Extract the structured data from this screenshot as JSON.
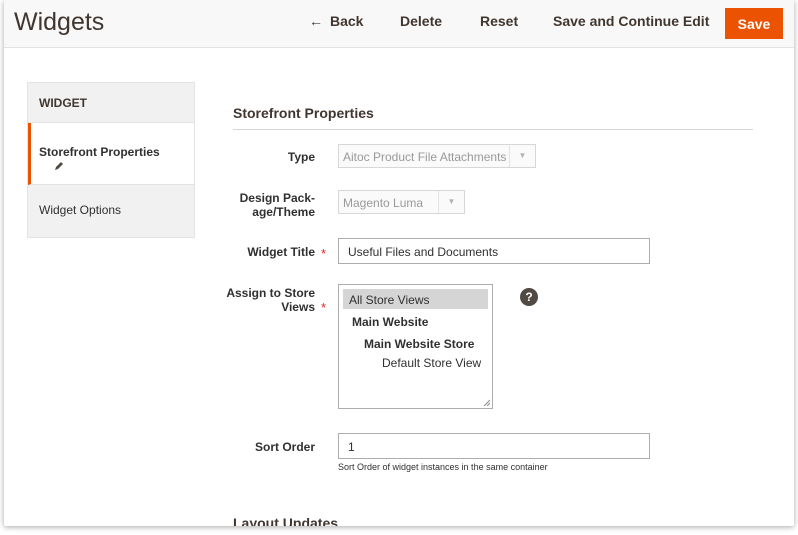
{
  "header": {
    "title": "Widgets",
    "back_label": "Back",
    "back_arrow": "←",
    "delete_label": "Delete",
    "reset_label": "Reset",
    "save_continue_label": "Save and Continue Edit",
    "save_label": "Save",
    "accent_color": "#eb5202"
  },
  "sidebar": {
    "heading": "WIDGET",
    "items": [
      {
        "label": "Storefront Properties",
        "active": true,
        "icon": "pencil-icon"
      },
      {
        "label": "Widget Options",
        "active": false
      }
    ]
  },
  "form": {
    "section_title": "Storefront Properties",
    "type": {
      "label": "Type",
      "value": "Aitoc Product File Attachments"
    },
    "theme": {
      "label_line1": "Design Pack-",
      "label_line2": "age/Theme",
      "value": "Magento Luma"
    },
    "widget_title": {
      "label": "Widget Title",
      "required_mark": "*",
      "value": "Useful Files and Documents"
    },
    "store_views": {
      "label_line1": "Assign to Store",
      "label_line2": "Views",
      "required_mark": "*",
      "options": [
        "All Store Views",
        "Main Website",
        "Main Website Store",
        "Default Store View"
      ],
      "selected": "All Store Views",
      "help_glyph": "?"
    },
    "sort_order": {
      "label": "Sort Order",
      "value": "1",
      "note": "Sort Order of widget instances in the same container"
    },
    "next_section_title": "Layout Updates"
  }
}
